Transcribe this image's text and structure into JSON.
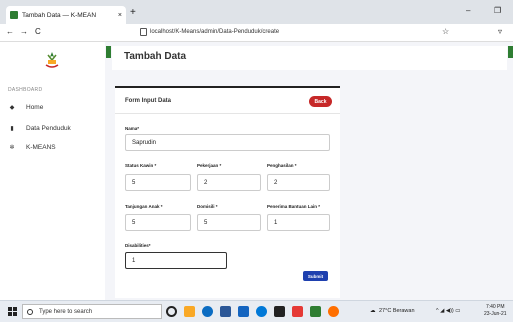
{
  "browser": {
    "tab_title": "Tambah Data — K-MEAN",
    "tab_close": "×",
    "new_tab": "+",
    "url": "localhost/K-Means/admin/Data-Penduduk/create",
    "back": "←",
    "forward": "→",
    "reload": "C",
    "minimize": "–",
    "restore": "❐"
  },
  "sidebar": {
    "heading": "DASHBOARD",
    "items": [
      {
        "label": "Home",
        "icon": "home-icon"
      },
      {
        "label": "Data Penduduk",
        "icon": "file-icon"
      },
      {
        "label": "K-MEANS",
        "icon": "cogs-icon"
      }
    ]
  },
  "header": {
    "title": "Tambah Data"
  },
  "form": {
    "title": "Form Input Data",
    "back_label": "Back",
    "nama": {
      "label": "Nama*",
      "value": "Saprudin"
    },
    "status_kawin": {
      "label": "Status Kawin *",
      "value": "5"
    },
    "pekerjaan": {
      "label": "Pekerjaan *",
      "value": "2"
    },
    "penghasilan": {
      "label": "Penghasilan *",
      "value": "2"
    },
    "tanggungan_anak": {
      "label": "Tanjungan Anak *",
      "value": "5"
    },
    "domisili": {
      "label": "Domisili *",
      "value": "5"
    },
    "penerima_bantuan": {
      "label": "Penerima Bantuan Lain *",
      "value": "1"
    },
    "disabilities": {
      "label": "Disabilities*",
      "value": "1"
    },
    "submit_label": "Submit"
  },
  "taskbar": {
    "search_placeholder": "Type here to search",
    "weather": "27°C Berawan",
    "time": "7:40 PM",
    "date": "23-Jun-21"
  },
  "colors": {
    "accent_green": "#2e7d32",
    "back_red": "#c62828",
    "submit_blue": "#1e40af"
  }
}
